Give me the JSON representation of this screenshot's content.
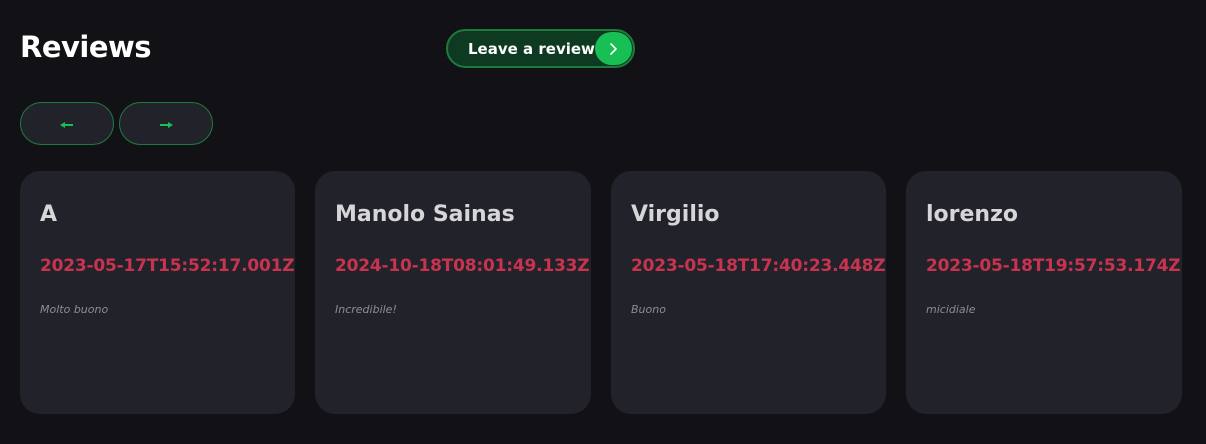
{
  "header": {
    "title": "Reviews",
    "leave_review_label": "Leave a review"
  },
  "colors": {
    "background": "#121216",
    "card": "#22232a",
    "accent": "#17bf55",
    "date": "#c8334f"
  },
  "reviews": [
    {
      "name": "A",
      "date": "2023-05-17T15:52:17.001Z",
      "text": "Molto buono"
    },
    {
      "name": "Manolo Sainas",
      "date": "2024-10-18T08:01:49.133Z",
      "text": "Incredibile!"
    },
    {
      "name": "Virgilio",
      "date": "2023-05-18T17:40:23.448Z",
      "text": "Buono"
    },
    {
      "name": "lorenzo",
      "date": "2023-05-18T19:57:53.174Z",
      "text": "micidiale"
    }
  ]
}
